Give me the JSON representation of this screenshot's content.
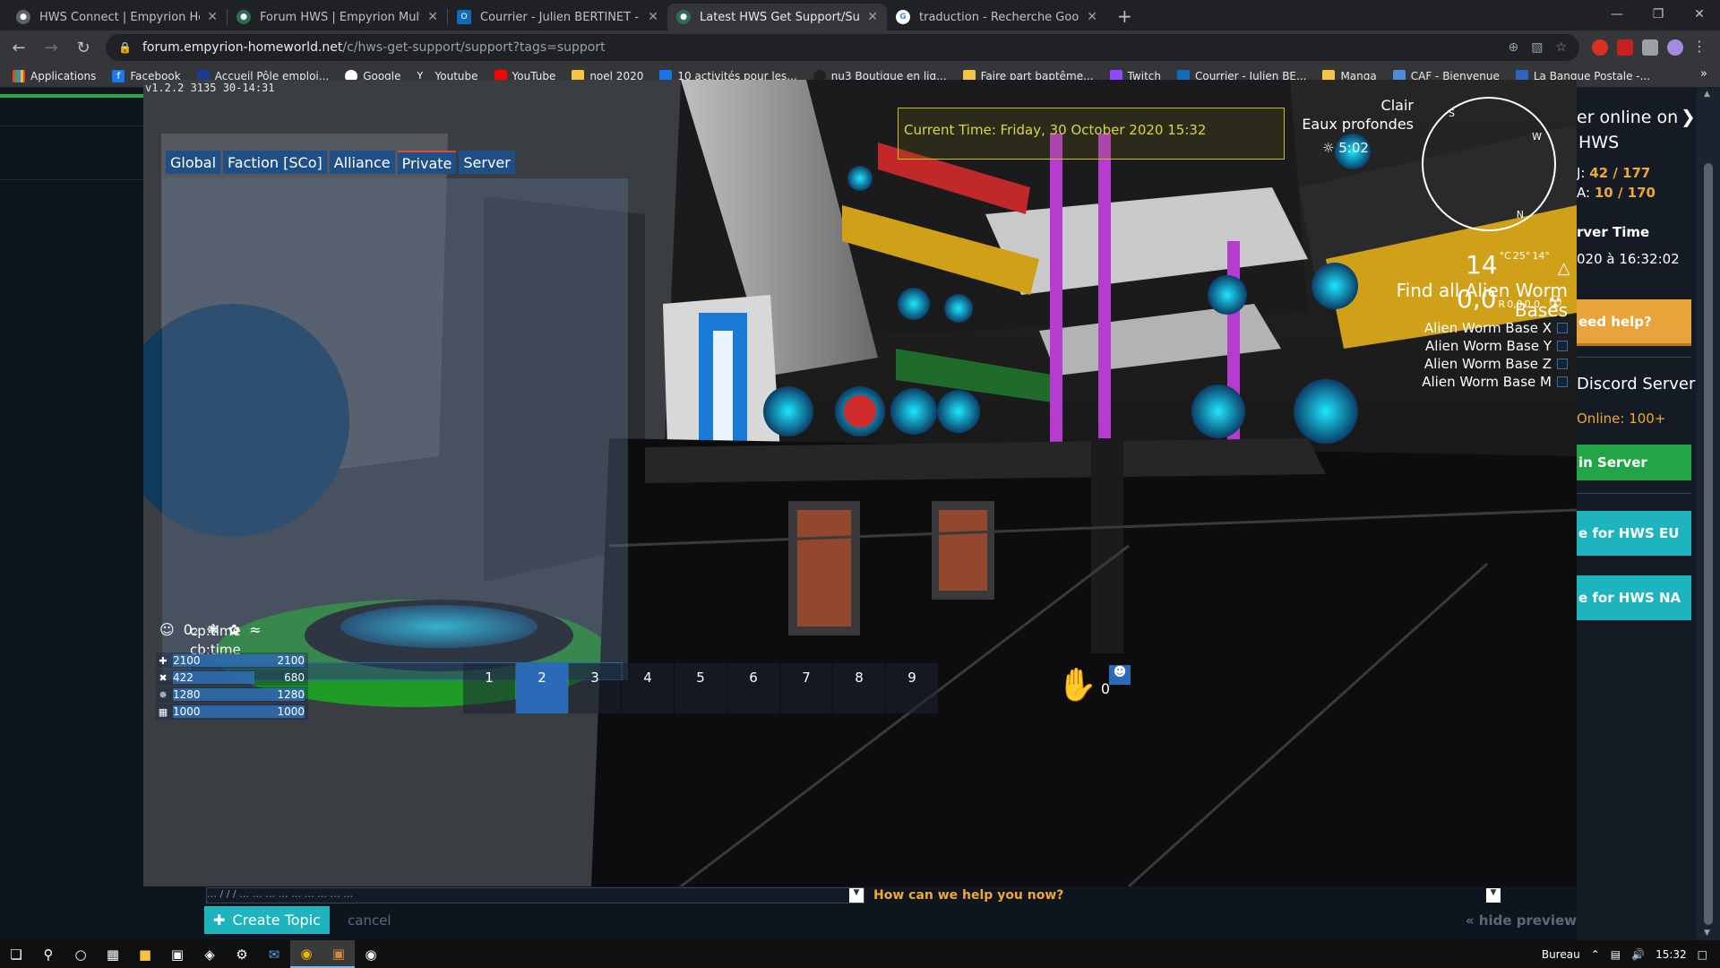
{
  "browser": {
    "tabs": [
      {
        "title": "HWS Connect | Empyrion Home…",
        "active": false
      },
      {
        "title": "Forum HWS | Empyrion Multiplay…",
        "active": false
      },
      {
        "title": "Courrier - Julien BERTINET - Outl…",
        "active": false
      },
      {
        "title": "Latest HWS Get Support/Suppor…",
        "active": true
      },
      {
        "title": "traduction - Recherche Google",
        "active": false
      }
    ],
    "url_host": "forum.empyrion-homeworld.net",
    "url_path": "/c/hws-get-support/support?tags=support",
    "bookmarks": [
      "Applications",
      "Facebook",
      "Accueil Pôle emploi...",
      "Google",
      "Youtube",
      "YouTube",
      "noel 2020",
      "10 activités pour les...",
      "nu3 Boutique en liq...",
      "Faire part baptême...",
      "Twitch",
      "Courrier - Julien BE...",
      "Manga",
      "CAF - Bienvenue",
      "La Banque Postale -..."
    ],
    "bookmarks_more": "»"
  },
  "site": {
    "right": {
      "online_title": "er online on",
      "online_sub": "HWS",
      "eu_label": "J:",
      "eu_value": "42 / 177",
      "na_label": "A:",
      "na_value": "10 / 170",
      "server_time_label": "rver Time",
      "server_time_value": "020 à 16:32:02",
      "need_help": "eed help?",
      "discord_title": "Discord Server",
      "discord_online": "Online: 100+",
      "join_server": "in Server",
      "hws_eu": "e for HWS EU",
      "hws_na": "e for HWS NA"
    },
    "composer": {
      "draft_text": "… / / / … … … … … … … … …",
      "how_help": "How can we help you now?",
      "create_topic": "Create Topic",
      "cancel": "cancel",
      "hide_preview": "« hide preview"
    }
  },
  "game": {
    "version": "v1.2.2 3135 30-14:31",
    "chat_tabs": [
      "Global",
      "Faction [SCo]",
      "Alliance",
      "Private",
      "Server"
    ],
    "chat_lines": [
      "cp:time",
      "cb:time"
    ],
    "current_time": "Current Time: Friday, 30 October 2020 15:32",
    "weather": {
      "condition": "Clair",
      "location": "Eaux profondes",
      "time": "5:02"
    },
    "compass_letters": [
      "S",
      "W",
      "N"
    ],
    "temperature": {
      "value": "14",
      "unit": "°C",
      "max": "25°",
      "min": "14°"
    },
    "radiation": {
      "value": "0,0",
      "unit": "R",
      "a": "0,0",
      "b": "0,0"
    },
    "mission": {
      "title": "Find all Alien Worm Bases",
      "objectives": [
        "Alien Worm Base X",
        "Alien Worm Base Y",
        "Alien Worm Base Z",
        "Alien Worm Base M"
      ]
    },
    "status_o2": "0",
    "status_o2_sub": "2",
    "stats": [
      {
        "icon": "health-icon",
        "glyph": "✚",
        "current": "2100",
        "max": "2100",
        "fraction": 1.0
      },
      {
        "icon": "food-icon",
        "glyph": "✖",
        "current": "422",
        "max": "680",
        "fraction": 0.62
      },
      {
        "icon": "stamina-icon",
        "glyph": "✵",
        "current": "1280",
        "max": "1280",
        "fraction": 1.0
      },
      {
        "icon": "oxygen-icon",
        "glyph": "▦",
        "current": "1000",
        "max": "1000",
        "fraction": 1.0
      }
    ],
    "hotbar": [
      "1",
      "2",
      "3",
      "4",
      "5",
      "6",
      "7",
      "8",
      "9",
      "0"
    ],
    "hotbar_selected": "2",
    "colors": {
      "accent": "#2b6ab6",
      "site_orange": "#e8a33a",
      "site_green": "#22a547",
      "site_teal": "#1eb4bd",
      "time_box": "#c6c21e"
    }
  },
  "taskbar": {
    "desktop_label": "Bureau",
    "time": "15:32"
  }
}
